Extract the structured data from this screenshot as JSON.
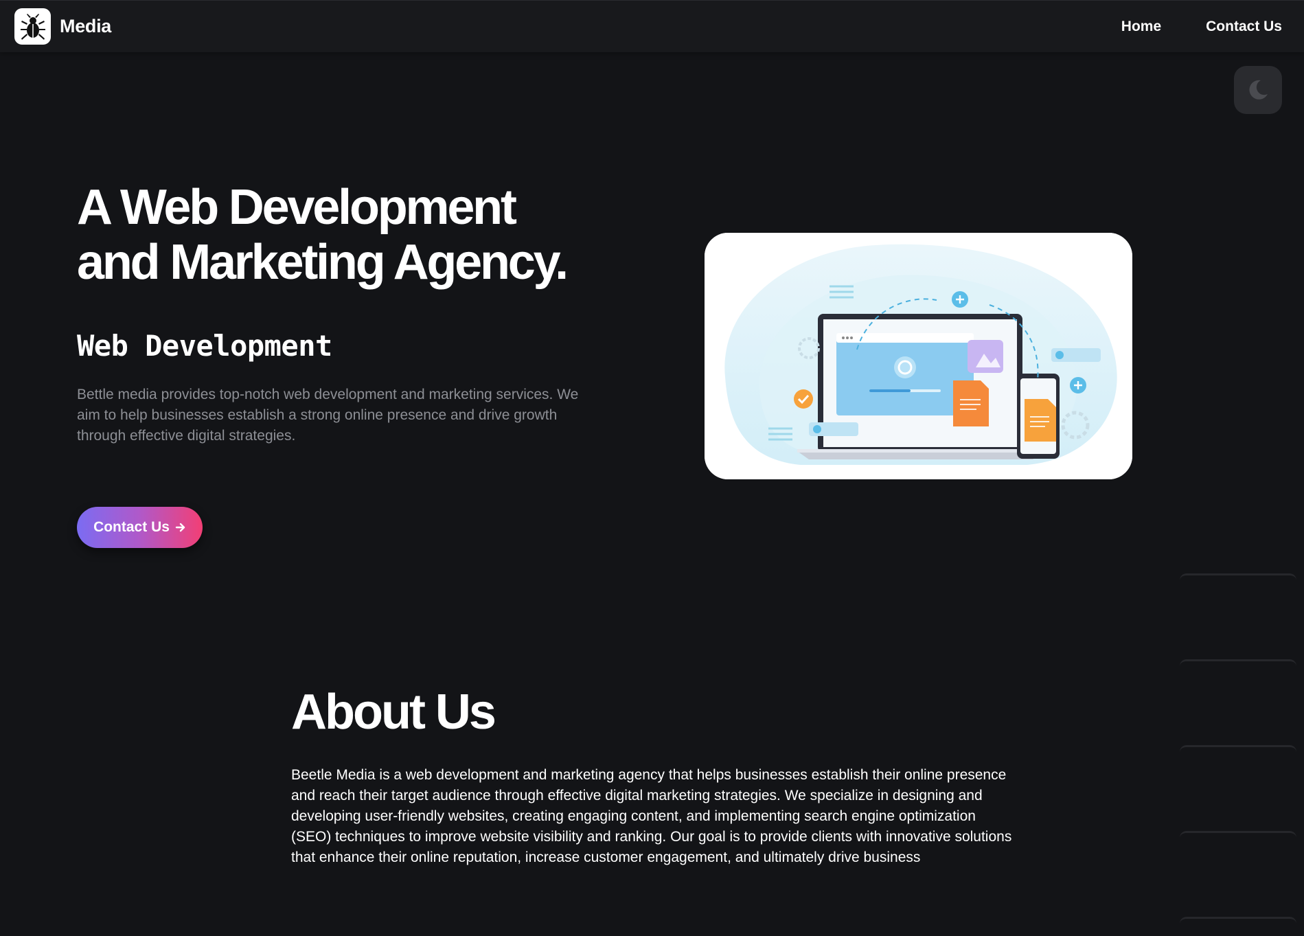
{
  "header": {
    "brand_name": "Media",
    "logo_icon": "beetle-icon",
    "nav": [
      {
        "label": "Home"
      },
      {
        "label": "Contact Us"
      }
    ]
  },
  "theme_toggle": {
    "icon": "moon-icon"
  },
  "hero": {
    "title_line1": "A Web Development",
    "title_line2": "and Marketing Agency.",
    "subtitle": "Web Development",
    "description": "Bettle media provides top-notch web development and marketing services. We aim to help businesses establish a strong online presence and drive growth through effective digital strategies.",
    "cta_label": "Contact Us",
    "cta_icon": "arrow-right-icon",
    "illustration": "web-development-illustration"
  },
  "about": {
    "title": "About Us",
    "text": "Beetle Media is a web development and marketing agency that helps businesses establish their online presence and reach their target audience through effective digital marketing strategies. We specialize in designing and developing user-friendly websites, creating engaging content, and implementing search engine optimization (SEO) techniques to improve website visibility and ranking. Our goal is to provide clients with innovative solutions that enhance their online reputation, increase customer engagement, and ultimately drive business"
  },
  "colors": {
    "background": "#131417",
    "header": "#18191c",
    "gradient_start": "#7b6cf2",
    "gradient_end": "#f23f75",
    "muted_text": "#8d8f95"
  }
}
